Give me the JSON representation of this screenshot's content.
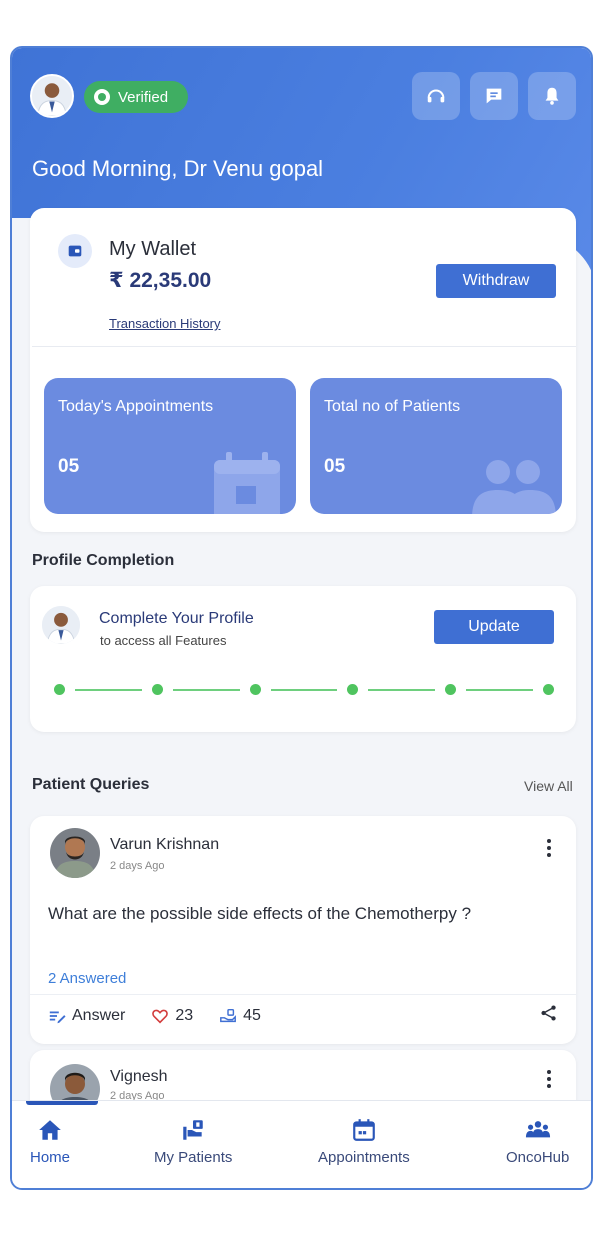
{
  "header": {
    "verified_label": "Verified",
    "greeting": "Good Morning, Dr Venu gopal",
    "icons": [
      "support-icon",
      "chat-icon",
      "bell-icon"
    ]
  },
  "wallet": {
    "title": "My Wallet",
    "amount": "₹ 22,35.00",
    "withdraw_label": "Withdraw",
    "history_link": "Transaction History"
  },
  "stats": [
    {
      "label": "Today's Appointments",
      "value": "05",
      "icon": "calendar-icon"
    },
    {
      "label": "Total no of Patients",
      "value": "05",
      "icon": "people-icon"
    }
  ],
  "profile": {
    "section_title": "Profile Completion",
    "title": "Complete Your Profile",
    "subtitle": "to access all Features",
    "update_label": "Update",
    "steps": 6
  },
  "queries": {
    "section_title": "Patient Queries",
    "view_all": "View All",
    "items": [
      {
        "name": "Varun Krishnan",
        "time": "2 days Ago",
        "question": "What are the possible side effects of the Chemotherpy ?",
        "answered": "2 Answered",
        "answer_label": "Answer",
        "likes": "23",
        "helps": "45"
      },
      {
        "name": "Vignesh",
        "time": "2 days Ago"
      }
    ]
  },
  "nav": [
    {
      "label": "Home",
      "icon": "home-icon"
    },
    {
      "label": "My Patients",
      "icon": "patients-icon"
    },
    {
      "label": "Appointments",
      "icon": "calendar-icon"
    },
    {
      "label": "OncoHub",
      "icon": "community-icon"
    }
  ],
  "colors": {
    "primary": "#3f6fd3",
    "stat_card": "#6b8be0",
    "verified": "#3fae62",
    "progress": "#4fc45f",
    "link": "#3f7fd9"
  }
}
